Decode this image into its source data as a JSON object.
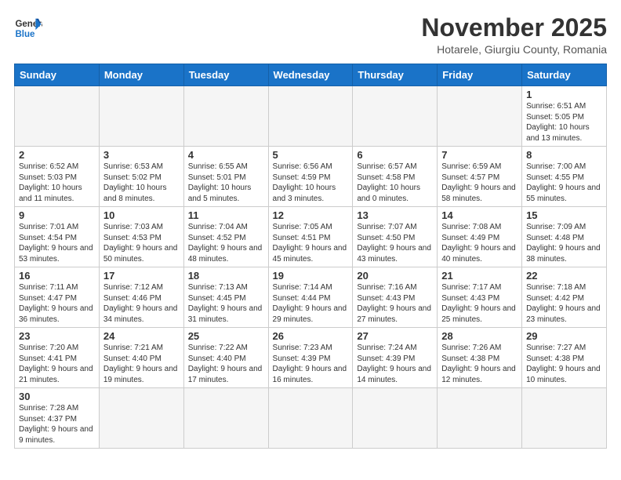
{
  "header": {
    "logo_text_regular": "General",
    "logo_text_blue": "Blue",
    "title": "November 2025",
    "subtitle": "Hotarele, Giurgiu County, Romania"
  },
  "days_of_week": [
    "Sunday",
    "Monday",
    "Tuesday",
    "Wednesday",
    "Thursday",
    "Friday",
    "Saturday"
  ],
  "weeks": [
    [
      {
        "day": "",
        "info": ""
      },
      {
        "day": "",
        "info": ""
      },
      {
        "day": "",
        "info": ""
      },
      {
        "day": "",
        "info": ""
      },
      {
        "day": "",
        "info": ""
      },
      {
        "day": "",
        "info": ""
      },
      {
        "day": "1",
        "info": "Sunrise: 6:51 AM\nSunset: 5:05 PM\nDaylight: 10 hours and 13 minutes."
      }
    ],
    [
      {
        "day": "2",
        "info": "Sunrise: 6:52 AM\nSunset: 5:03 PM\nDaylight: 10 hours and 11 minutes."
      },
      {
        "day": "3",
        "info": "Sunrise: 6:53 AM\nSunset: 5:02 PM\nDaylight: 10 hours and 8 minutes."
      },
      {
        "day": "4",
        "info": "Sunrise: 6:55 AM\nSunset: 5:01 PM\nDaylight: 10 hours and 5 minutes."
      },
      {
        "day": "5",
        "info": "Sunrise: 6:56 AM\nSunset: 4:59 PM\nDaylight: 10 hours and 3 minutes."
      },
      {
        "day": "6",
        "info": "Sunrise: 6:57 AM\nSunset: 4:58 PM\nDaylight: 10 hours and 0 minutes."
      },
      {
        "day": "7",
        "info": "Sunrise: 6:59 AM\nSunset: 4:57 PM\nDaylight: 9 hours and 58 minutes."
      },
      {
        "day": "8",
        "info": "Sunrise: 7:00 AM\nSunset: 4:55 PM\nDaylight: 9 hours and 55 minutes."
      }
    ],
    [
      {
        "day": "9",
        "info": "Sunrise: 7:01 AM\nSunset: 4:54 PM\nDaylight: 9 hours and 53 minutes."
      },
      {
        "day": "10",
        "info": "Sunrise: 7:03 AM\nSunset: 4:53 PM\nDaylight: 9 hours and 50 minutes."
      },
      {
        "day": "11",
        "info": "Sunrise: 7:04 AM\nSunset: 4:52 PM\nDaylight: 9 hours and 48 minutes."
      },
      {
        "day": "12",
        "info": "Sunrise: 7:05 AM\nSunset: 4:51 PM\nDaylight: 9 hours and 45 minutes."
      },
      {
        "day": "13",
        "info": "Sunrise: 7:07 AM\nSunset: 4:50 PM\nDaylight: 9 hours and 43 minutes."
      },
      {
        "day": "14",
        "info": "Sunrise: 7:08 AM\nSunset: 4:49 PM\nDaylight: 9 hours and 40 minutes."
      },
      {
        "day": "15",
        "info": "Sunrise: 7:09 AM\nSunset: 4:48 PM\nDaylight: 9 hours and 38 minutes."
      }
    ],
    [
      {
        "day": "16",
        "info": "Sunrise: 7:11 AM\nSunset: 4:47 PM\nDaylight: 9 hours and 36 minutes."
      },
      {
        "day": "17",
        "info": "Sunrise: 7:12 AM\nSunset: 4:46 PM\nDaylight: 9 hours and 34 minutes."
      },
      {
        "day": "18",
        "info": "Sunrise: 7:13 AM\nSunset: 4:45 PM\nDaylight: 9 hours and 31 minutes."
      },
      {
        "day": "19",
        "info": "Sunrise: 7:14 AM\nSunset: 4:44 PM\nDaylight: 9 hours and 29 minutes."
      },
      {
        "day": "20",
        "info": "Sunrise: 7:16 AM\nSunset: 4:43 PM\nDaylight: 9 hours and 27 minutes."
      },
      {
        "day": "21",
        "info": "Sunrise: 7:17 AM\nSunset: 4:43 PM\nDaylight: 9 hours and 25 minutes."
      },
      {
        "day": "22",
        "info": "Sunrise: 7:18 AM\nSunset: 4:42 PM\nDaylight: 9 hours and 23 minutes."
      }
    ],
    [
      {
        "day": "23",
        "info": "Sunrise: 7:20 AM\nSunset: 4:41 PM\nDaylight: 9 hours and 21 minutes."
      },
      {
        "day": "24",
        "info": "Sunrise: 7:21 AM\nSunset: 4:40 PM\nDaylight: 9 hours and 19 minutes."
      },
      {
        "day": "25",
        "info": "Sunrise: 7:22 AM\nSunset: 4:40 PM\nDaylight: 9 hours and 17 minutes."
      },
      {
        "day": "26",
        "info": "Sunrise: 7:23 AM\nSunset: 4:39 PM\nDaylight: 9 hours and 16 minutes."
      },
      {
        "day": "27",
        "info": "Sunrise: 7:24 AM\nSunset: 4:39 PM\nDaylight: 9 hours and 14 minutes."
      },
      {
        "day": "28",
        "info": "Sunrise: 7:26 AM\nSunset: 4:38 PM\nDaylight: 9 hours and 12 minutes."
      },
      {
        "day": "29",
        "info": "Sunrise: 7:27 AM\nSunset: 4:38 PM\nDaylight: 9 hours and 10 minutes."
      }
    ],
    [
      {
        "day": "30",
        "info": "Sunrise: 7:28 AM\nSunset: 4:37 PM\nDaylight: 9 hours and 9 minutes."
      },
      {
        "day": "",
        "info": ""
      },
      {
        "day": "",
        "info": ""
      },
      {
        "day": "",
        "info": ""
      },
      {
        "day": "",
        "info": ""
      },
      {
        "day": "",
        "info": ""
      },
      {
        "day": "",
        "info": ""
      }
    ]
  ]
}
